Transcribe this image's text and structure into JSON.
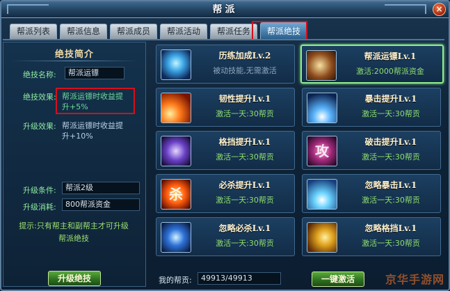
{
  "window": {
    "title": "帮派",
    "close_label": "×"
  },
  "tabs": [
    {
      "label": "帮派列表",
      "active": false
    },
    {
      "label": "帮派信息",
      "active": false
    },
    {
      "label": "帮派成员",
      "active": false
    },
    {
      "label": "帮派活动",
      "active": false
    },
    {
      "label": "帮派任务",
      "active": false
    },
    {
      "label": "帮派绝技",
      "active": true
    }
  ],
  "left": {
    "title": "绝技简介",
    "name_label": "绝技名称:",
    "name_value": "帮派运镖",
    "effect_label": "绝技效果:",
    "effect_line1": "帮派运镖时收益提",
    "effect_line2": "升+5%",
    "upgrade_effect_label": "升级效果:",
    "upgrade_effect_line1": "帮派运镖时收益提",
    "upgrade_effect_line2": "升+10%",
    "condition_label": "升级条件:",
    "condition_value": "帮派2级",
    "cost_label": "升级消耗:",
    "cost_value": "800帮派资金",
    "tip_line1": "提示:只有帮主和副帮主才可升级",
    "tip_line2": "帮派绝技",
    "upgrade_button": "升级绝技"
  },
  "skills": [
    {
      "name": "历练加成Lv.2",
      "sub": "被动技能,无需激活",
      "icon": "aura-icon",
      "glyph": "",
      "selected": false,
      "gray": true
    },
    {
      "name": "帮派运镖Lv.1",
      "sub": "激活:2000帮派资金",
      "icon": "cart-icon",
      "glyph": "",
      "selected": true,
      "gray": false
    },
    {
      "name": "韧性提升Lv.1",
      "sub": "激活一天:30帮贡",
      "icon": "fire-slash-icon",
      "glyph": "",
      "selected": false,
      "gray": false
    },
    {
      "name": "暴击提升Lv.1",
      "sub": "激活一天:30帮贡",
      "icon": "burst-icon",
      "glyph": "",
      "selected": false,
      "gray": false
    },
    {
      "name": "格挡提升Lv.1",
      "sub": "激活一天:30帮贡",
      "icon": "shield-icon",
      "glyph": "",
      "selected": false,
      "gray": false
    },
    {
      "name": "破击提升Lv.1",
      "sub": "激活一天:30帮贡",
      "icon": "break-icon",
      "glyph": "攻",
      "selected": false,
      "gray": false
    },
    {
      "name": "必杀提升Lv.1",
      "sub": "激活一天:30帮贡",
      "icon": "kill-rune-icon",
      "glyph": "杀",
      "selected": false,
      "gray": false
    },
    {
      "name": "忽略暴击Lv.1",
      "sub": "激活一天:30帮贡",
      "icon": "lightning-icon",
      "glyph": "",
      "selected": false,
      "gray": false
    },
    {
      "name": "忽略必杀Lv.1",
      "sub": "激活一天:30帮贡",
      "icon": "yin-yang-icon",
      "glyph": "",
      "selected": false,
      "gray": false
    },
    {
      "name": "忽略格挡Lv.1",
      "sub": "激活一天:30帮贡",
      "icon": "golden-slash-icon",
      "glyph": "",
      "selected": false,
      "gray": false
    }
  ],
  "footer": {
    "contrib_label": "我的帮贡:",
    "contrib_value": "49913/49913",
    "activate_all_button": "一键激活",
    "watermark": "京华手游网"
  }
}
